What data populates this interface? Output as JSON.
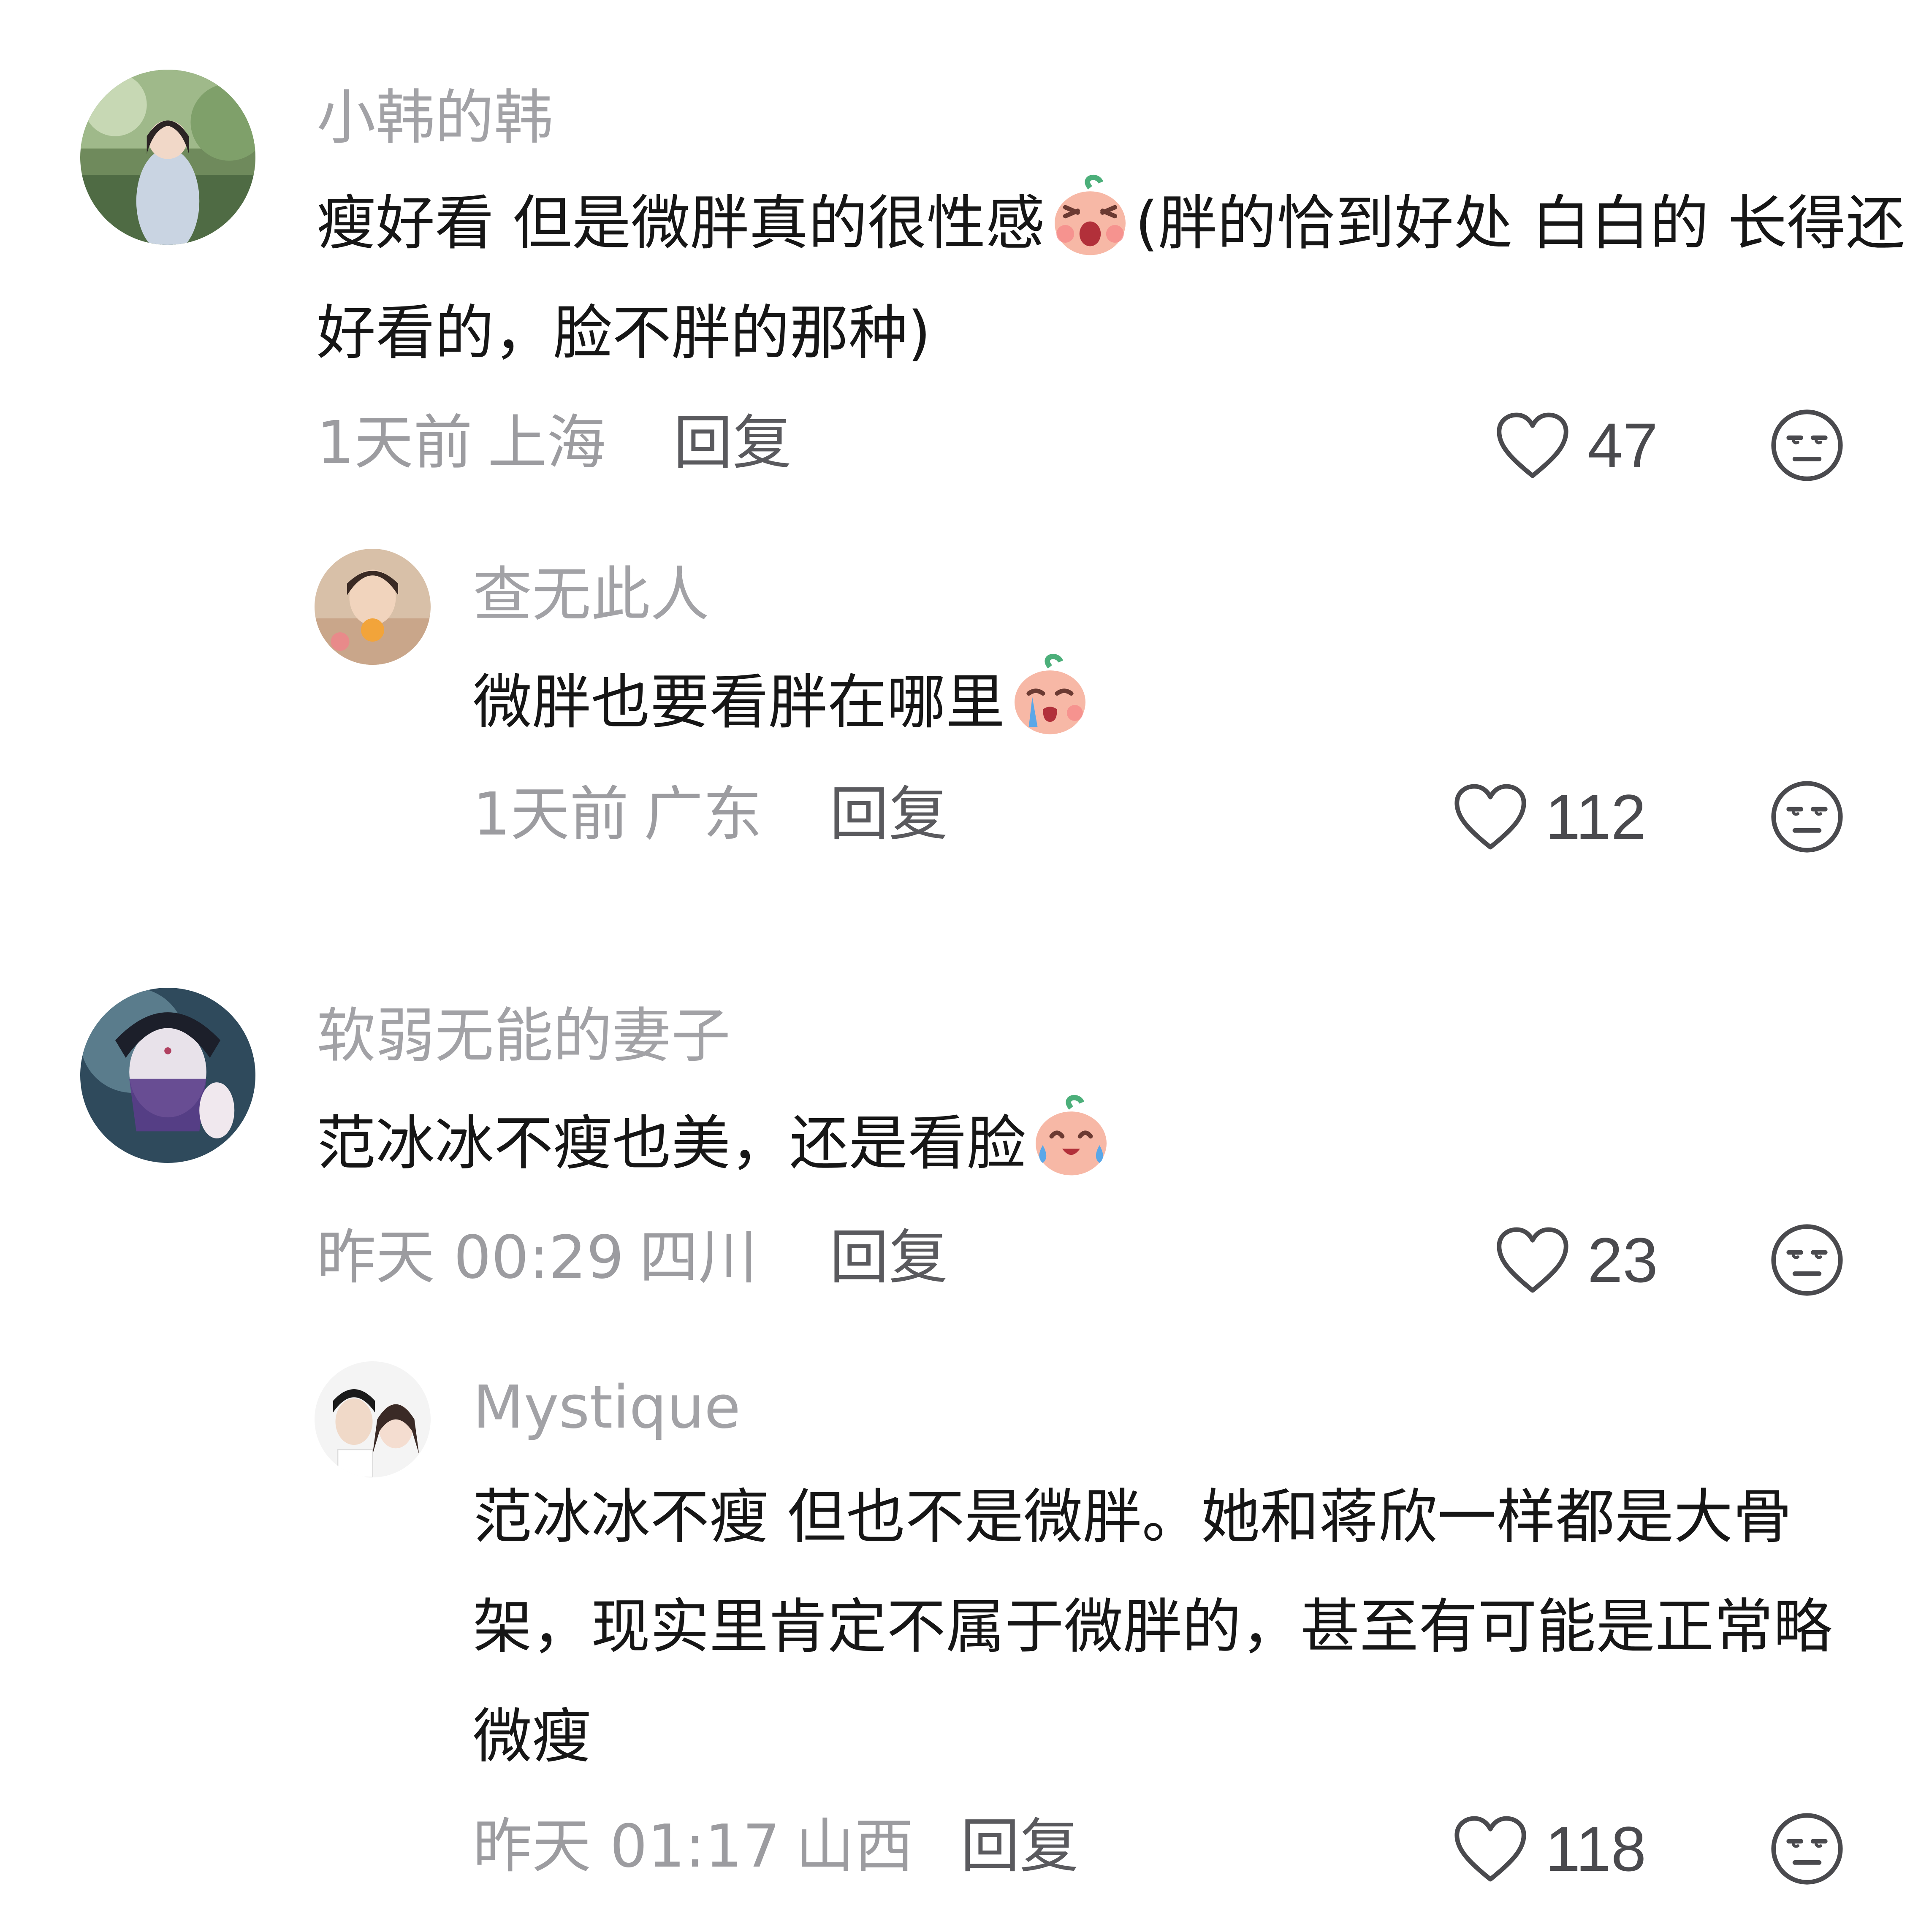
{
  "comments": [
    {
      "username": "小韩的韩",
      "text_before": "瘦好看 但是微胖真的很性感",
      "emoji": "screaming-face-emoji",
      "text_after": "(胖的恰到好处 白白的 长得还好看的，脸不胖的那种)",
      "time": "1天前",
      "location": "上海",
      "reply_label": "回复",
      "likes": "47",
      "avatar": "avatar-girl-garden"
    },
    {
      "username": "查无此人",
      "text_before": "微胖也要看胖在哪里",
      "emoji": "crying-face-emoji",
      "text_after": "",
      "time": "1天前",
      "location": "广东",
      "reply_label": "回复",
      "likes": "112",
      "avatar": "avatar-girl-orange"
    },
    {
      "username": "软弱无能的妻子",
      "text_before": "范冰冰不瘦也美，还是看脸",
      "emoji": "tears-of-joy-emoji",
      "text_after": "",
      "time": "昨天 00:29",
      "location": "四川",
      "reply_label": "回复",
      "likes": "23",
      "avatar": "avatar-veiled-woman"
    },
    {
      "username": "Mystique",
      "text_before": "范冰冰不瘦 但也不是微胖。她和蒋欣一样都是大骨架，现实里肯定不属于微胖的，甚至有可能是正常略微瘦",
      "emoji": "",
      "text_after": "",
      "time": "昨天 01:17",
      "location": "山西",
      "reply_label": "回复",
      "likes": "118",
      "avatar": "avatar-couple"
    }
  ],
  "icons": {
    "like": "heart-outline-icon",
    "dislike": "unamused-face-icon"
  },
  "colors": {
    "username": "#a2a2a6",
    "body_text": "#161616",
    "meta_text": "#9c9ca0",
    "reply_text": "#5a5a5e",
    "icon_stroke": "#4a4a4e",
    "emoji_peach": "#f7b8a6"
  }
}
